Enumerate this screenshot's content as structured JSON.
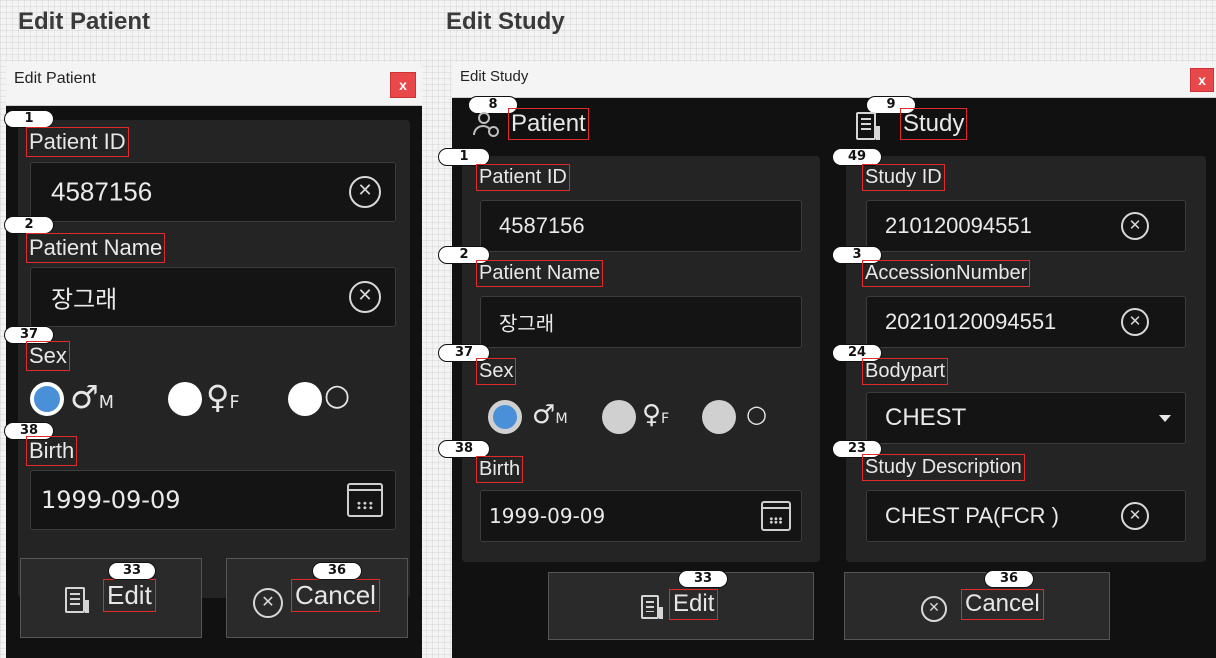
{
  "headings": {
    "left": "Edit Patient",
    "right": "Edit Study"
  },
  "left_dialog": {
    "title": "Edit Patient",
    "close": "x",
    "patient_id_label": "Patient ID",
    "patient_id_value": "4587156",
    "patient_name_label": "Patient Name",
    "patient_name_value": "장그래",
    "sex_label": "Sex",
    "sex_options": [
      {
        "symbol": "♂",
        "sub": "M",
        "selected": true
      },
      {
        "symbol": "♀",
        "sub": "F",
        "selected": false
      },
      {
        "symbol": "○",
        "sub": "",
        "selected": false
      }
    ],
    "birth_label": "Birth",
    "birth_value": "1999-09-09",
    "edit_button": "Edit",
    "cancel_button": "Cancel",
    "badges": {
      "patient_id": "1",
      "patient_name": "2",
      "sex": "37",
      "birth": "38",
      "edit": "33",
      "cancel": "36"
    }
  },
  "right_dialog": {
    "title": "Edit Study",
    "close": "x",
    "patient_section_label": "Patient",
    "study_section_label": "Study",
    "patient_id_label": "Patient ID",
    "patient_id_value": "4587156",
    "patient_name_label": "Patient Name",
    "patient_name_value": "장그래",
    "sex_label": "Sex",
    "sex_options": [
      {
        "symbol": "♂",
        "sub": "M",
        "selected": true
      },
      {
        "symbol": "♀",
        "sub": "F",
        "selected": false
      },
      {
        "symbol": "○",
        "sub": "",
        "selected": false
      }
    ],
    "birth_label": "Birth",
    "birth_value": "1999-09-09",
    "study_id_label": "Study ID",
    "study_id_value": "210120094551",
    "accession_label": "AccessionNumber",
    "accession_value": "20210120094551",
    "bodypart_label": "Bodypart",
    "bodypart_value": "CHEST",
    "study_desc_label": "Study Description",
    "study_desc_value": "CHEST PA(FCR )",
    "edit_button": "Edit",
    "cancel_button": "Cancel",
    "badges": {
      "patient_section": "8",
      "study_section": "9",
      "patient_id": "1",
      "patient_name": "2",
      "sex": "37",
      "birth": "38",
      "study_id": "49",
      "accession": "3",
      "bodypart": "24",
      "study_desc": "23",
      "edit": "33",
      "cancel": "36"
    }
  },
  "icons": {
    "clear": "⊗",
    "calendar": "calendar-icon",
    "edit": "document-edit-icon",
    "dropdown": "chevron-down-icon",
    "person": "patient-icon"
  },
  "colors": {
    "annotation": "#e12a2a",
    "radio_selected": "#4a90d9",
    "close": "#e8484a"
  }
}
